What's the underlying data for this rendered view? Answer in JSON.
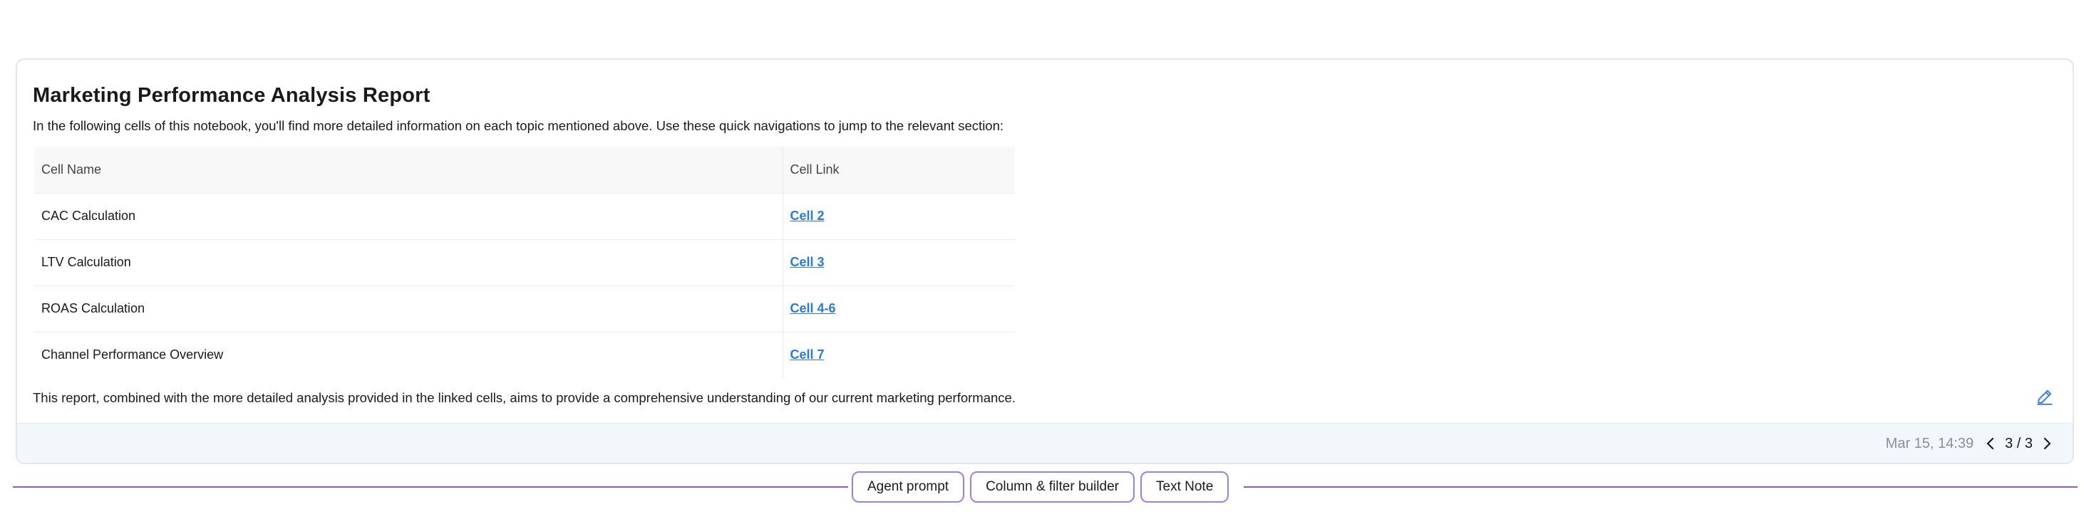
{
  "cell": {
    "title": "Marketing Performance Analysis Report",
    "intro": "In the following cells of this notebook, you'll find more detailed information on each topic mentioned above. Use these quick navigations to jump to the relevant section:",
    "table": {
      "headers": [
        "Cell Name",
        "Cell Link"
      ],
      "rows": [
        {
          "name": "CAC Calculation",
          "link": "Cell 2"
        },
        {
          "name": "LTV Calculation",
          "link": "Cell 3"
        },
        {
          "name": "ROAS Calculation",
          "link": "Cell 4-6"
        },
        {
          "name": "Channel Performance Overview",
          "link": "Cell 7"
        }
      ]
    },
    "summary": "This report, combined with the more detailed analysis provided in the linked cells, aims to provide a comprehensive understanding of our current marketing performance.",
    "edit_icon": "pencil-icon"
  },
  "footer": {
    "timestamp": "Mar 15, 14:39",
    "page_indicator": "3 / 3",
    "prev_icon": "chevron-left-icon",
    "next_icon": "chevron-right-icon"
  },
  "add_bar": {
    "buttons": [
      "Agent prompt",
      "Column & filter builder",
      "Text Note"
    ]
  },
  "colors": {
    "link": "#2a7ad6",
    "accent": "#8a5cd9",
    "footer_bg": "#f1f7fb"
  }
}
